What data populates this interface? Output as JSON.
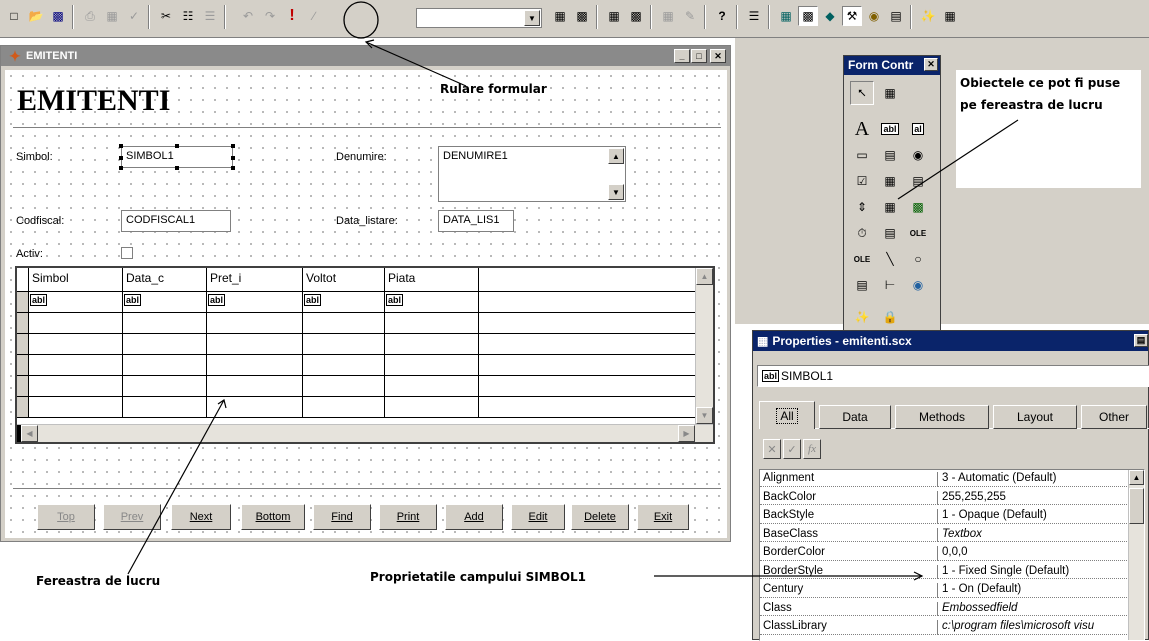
{
  "toolbar": {
    "combo_value": "",
    "buttons_left": [
      "new-icon",
      "open-icon",
      "save-icon",
      "print-icon",
      "print-preview-icon",
      "spell-check-icon",
      "cut-icon",
      "copy-icon",
      "paste-icon",
      "undo-icon",
      "redo-icon",
      "run-icon",
      "modify-icon"
    ],
    "run_glyph": "!"
  },
  "form_window": {
    "title": "EMITENTI",
    "heading": "EMITENTI",
    "labels": {
      "simbol": "Simbol:",
      "denumire": "Denumire:",
      "codfiscal": "Codfiscal:",
      "data_listare": "Data_listare:",
      "activ": "Activ:"
    },
    "fields": {
      "simbol": "SIMBOL1",
      "denumire": "DENUMIRE1",
      "codfiscal": "CODFISCAL1",
      "data_listare": "DATA_LIS1"
    },
    "grid": {
      "columns": [
        "Simbol",
        "Data_c",
        "Pret_i",
        "Voltot",
        "Piata"
      ],
      "cell_glyph": "abl"
    },
    "nav_buttons": [
      {
        "label": "Top",
        "enabled": false
      },
      {
        "label": "Prev",
        "enabled": false
      },
      {
        "label": "Next",
        "enabled": true
      },
      {
        "label": "Bottom",
        "enabled": true
      },
      {
        "label": "Find",
        "enabled": true
      },
      {
        "label": "Print",
        "enabled": true
      },
      {
        "label": "Add",
        "enabled": true
      },
      {
        "label": "Edit",
        "enabled": true
      },
      {
        "label": "Delete",
        "enabled": true
      },
      {
        "label": "Exit",
        "enabled": true
      }
    ]
  },
  "form_controls": {
    "title": "Form Contr"
  },
  "properties": {
    "title": "Properties - emitenti.scx",
    "object_combo": "SIMBOL1",
    "tabs": [
      "All",
      "Data",
      "Methods",
      "Layout",
      "Other"
    ],
    "active_tab": "All",
    "rows": [
      {
        "name": "Alignment",
        "value": "3 - Automatic (Default)",
        "italic": false
      },
      {
        "name": "BackColor",
        "value": "255,255,255",
        "italic": false
      },
      {
        "name": "BackStyle",
        "value": "1 - Opaque (Default)",
        "italic": false
      },
      {
        "name": "BaseClass",
        "value": "Textbox",
        "italic": true
      },
      {
        "name": "BorderColor",
        "value": "0,0,0",
        "italic": false
      },
      {
        "name": "BorderStyle",
        "value": "1 - Fixed Single (Default)",
        "italic": false
      },
      {
        "name": "Century",
        "value": "1 - On (Default)",
        "italic": false
      },
      {
        "name": "Class",
        "value": "Embossedfield",
        "italic": true
      },
      {
        "name": "ClassLibrary",
        "value": "c:\\program files\\microsoft visu",
        "italic": true
      }
    ]
  },
  "annotations": {
    "run": "Rulare formular",
    "objects": "Obiectele ce pot fi puse pe fereastra de lucru",
    "workarea": "Fereastra de lucru",
    "props": "Proprietatile campului SIMBOL1"
  }
}
